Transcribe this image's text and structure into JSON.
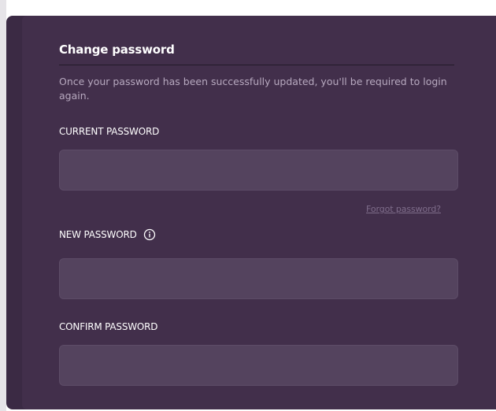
{
  "colors": {
    "panel_background": "#3b2a44",
    "card_background": "#422f4b",
    "input_background": "#54435e",
    "title_text": "#ffffff",
    "description_text": "#b7a9bf",
    "link_text": "#7f6d8b"
  },
  "form": {
    "title": "Change password",
    "description": "Once your password has been successfully updated, you'll be required to login again.",
    "current_password": {
      "label": "CURRENT PASSWORD",
      "value": "",
      "placeholder": ""
    },
    "forgot_password_link": "Forgot password?",
    "new_password": {
      "label": "NEW PASSWORD",
      "info_icon": "info-icon",
      "value": "",
      "placeholder": ""
    },
    "confirm_password": {
      "label": "CONFIRM PASSWORD",
      "value": "",
      "placeholder": ""
    }
  }
}
